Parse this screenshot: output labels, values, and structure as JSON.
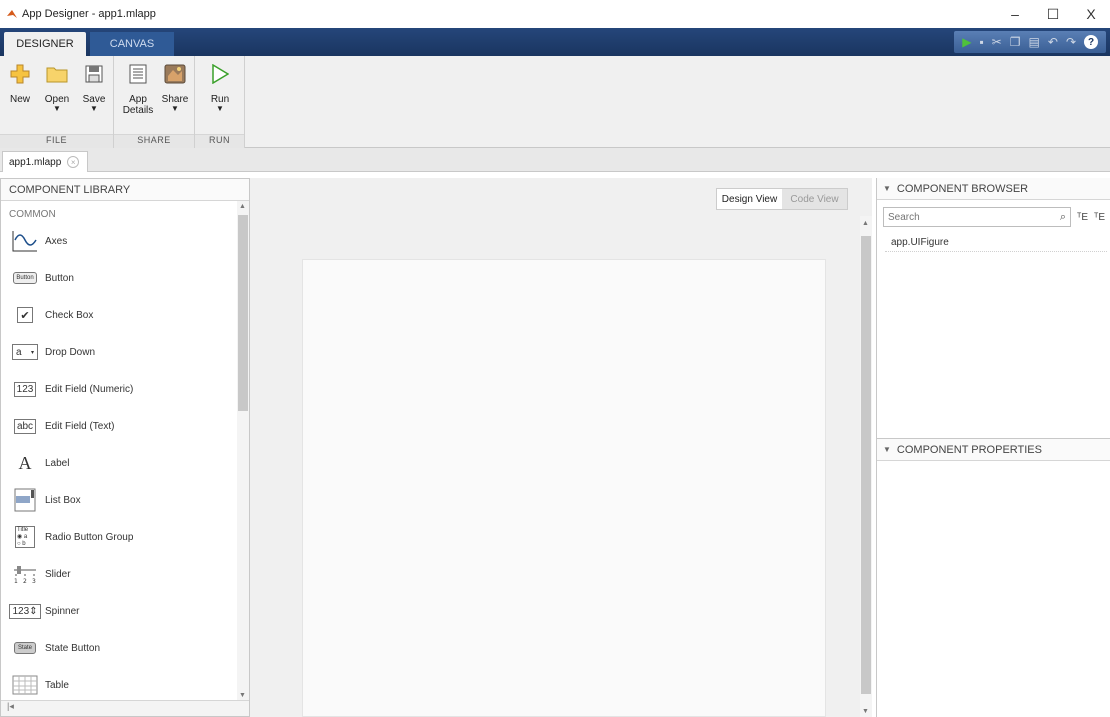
{
  "window": {
    "title": "App Designer - app1.mlapp",
    "minimize": "–",
    "maximize": "☐",
    "close": "X"
  },
  "toolstrip": {
    "tabs": [
      {
        "label": "DESIGNER"
      },
      {
        "label": "CANVAS"
      }
    ],
    "quick_access": {
      "help": "?"
    }
  },
  "ribbon": {
    "groups": [
      {
        "label": "FILE",
        "buttons": [
          {
            "label": "New",
            "icon": "new-plus-icon"
          },
          {
            "label": "Open",
            "icon": "folder-icon",
            "caret": "▼"
          },
          {
            "label": "Save",
            "icon": "save-icon",
            "caret": "▼"
          }
        ]
      },
      {
        "label": "SHARE",
        "buttons": [
          {
            "label": "App Details",
            "icon": "app-details-icon"
          },
          {
            "label": "Share",
            "icon": "share-icon",
            "caret": "▼"
          }
        ]
      },
      {
        "label": "RUN",
        "buttons": [
          {
            "label": "Run",
            "icon": "run-icon",
            "caret": "▼"
          }
        ]
      }
    ]
  },
  "document_tab": {
    "label": "app1.mlapp",
    "close": "×"
  },
  "component_library": {
    "title": "COMPONENT LIBRARY",
    "section": "COMMON",
    "items": [
      {
        "label": "Axes",
        "icon": "axes-icon"
      },
      {
        "label": "Button",
        "icon": "button-icon",
        "icon_text": "Button"
      },
      {
        "label": "Check Box",
        "icon": "checkbox-icon",
        "icon_text": "✔"
      },
      {
        "label": "Drop Down",
        "icon": "dropdown-icon",
        "icon_text": "a"
      },
      {
        "label": "Edit Field (Numeric)",
        "icon": "numeric-field-icon",
        "icon_text": "123"
      },
      {
        "label": "Edit Field (Text)",
        "icon": "text-field-icon",
        "icon_text": "abc"
      },
      {
        "label": "Label",
        "icon": "label-icon",
        "icon_text": "A"
      },
      {
        "label": "List Box",
        "icon": "listbox-icon"
      },
      {
        "label": "Radio Button Group",
        "icon": "radio-group-icon",
        "icon_text": "Title"
      },
      {
        "label": "Slider",
        "icon": "slider-icon"
      },
      {
        "label": "Spinner",
        "icon": "spinner-icon",
        "icon_text": "123"
      },
      {
        "label": "State Button",
        "icon": "state-button-icon",
        "icon_text": "State"
      },
      {
        "label": "Table",
        "icon": "table-icon"
      }
    ]
  },
  "canvas": {
    "design_view": "Design View",
    "code_view": "Code View"
  },
  "component_browser": {
    "title": "COMPONENT BROWSER",
    "search_placeholder": "Search",
    "items": [
      {
        "label": "app.UIFigure"
      }
    ]
  },
  "component_properties": {
    "title": "COMPONENT PROPERTIES"
  }
}
